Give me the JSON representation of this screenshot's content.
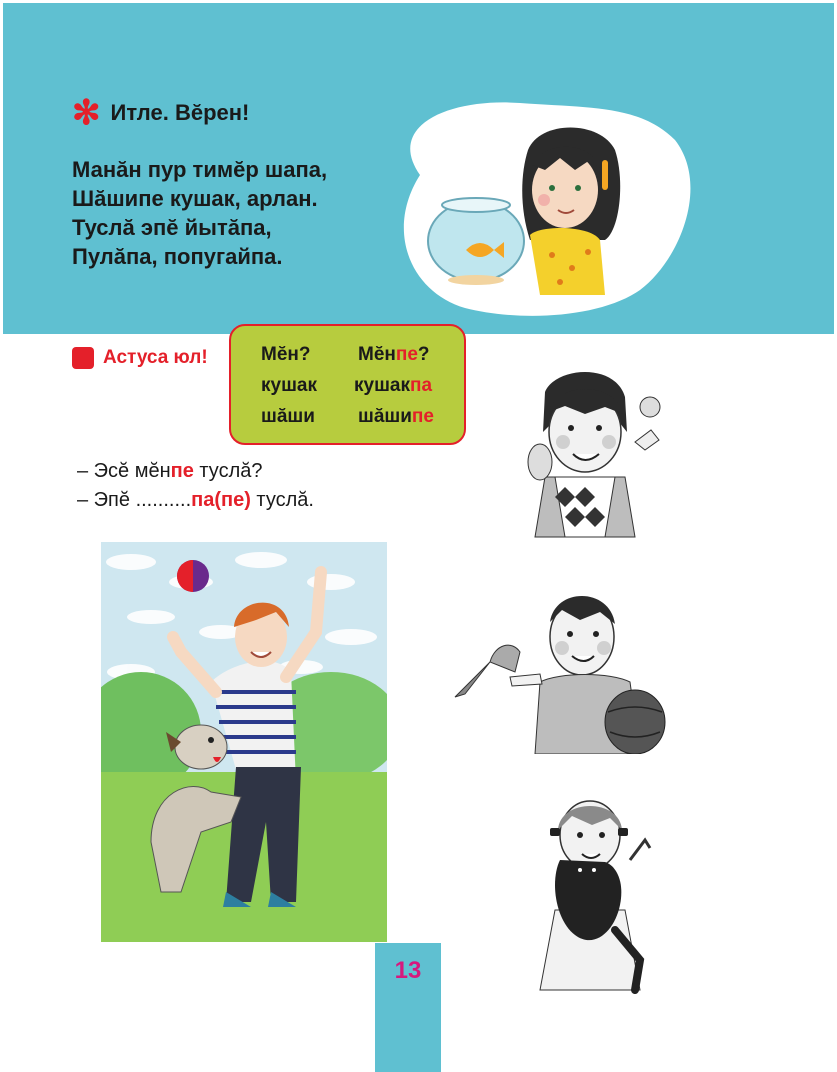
{
  "exercise": {
    "marker_icon": "asterisk-icon",
    "heading": "Итле. Вĕрен!",
    "poem": [
      "Манăн пур тимĕр шапа,",
      "Шăшипе кушак, арлан.",
      "Туслă эпĕ йытăпа,",
      "Пулăпа, попугайпа."
    ]
  },
  "remember": {
    "icon": "red-square-icon",
    "label": "Астуса юл!"
  },
  "rule_table": {
    "col1_header": "Мĕн?",
    "col2_header_base": "Мĕн",
    "col2_header_suffix": "пе",
    "col2_header_q": "?",
    "row1_word": "кушак",
    "row1_base": "кушак",
    "row1_suffix": "па",
    "row2_word": "шăши",
    "row2_base": "шăши",
    "row2_suffix": "пе"
  },
  "dialogue": {
    "line1_prefix": "– Эсĕ мĕн",
    "line1_highlight": "пе",
    "line1_suffix": " туслă?",
    "line2_prefix": "– Эпĕ ..........",
    "line2_highlight": "па(пе)",
    "line2_suffix": " туслă."
  },
  "page_number": "13",
  "colors": {
    "band": "#5fc0d1",
    "accent_red": "#e4202a",
    "rule_box": "#b7cc3e",
    "page_number": "#d6197e"
  },
  "illustrations": [
    "girl-with-fishbowl",
    "boy-with-mouse",
    "boy-with-parrot-and-ball",
    "girl-with-cat",
    "boy-with-dog"
  ]
}
